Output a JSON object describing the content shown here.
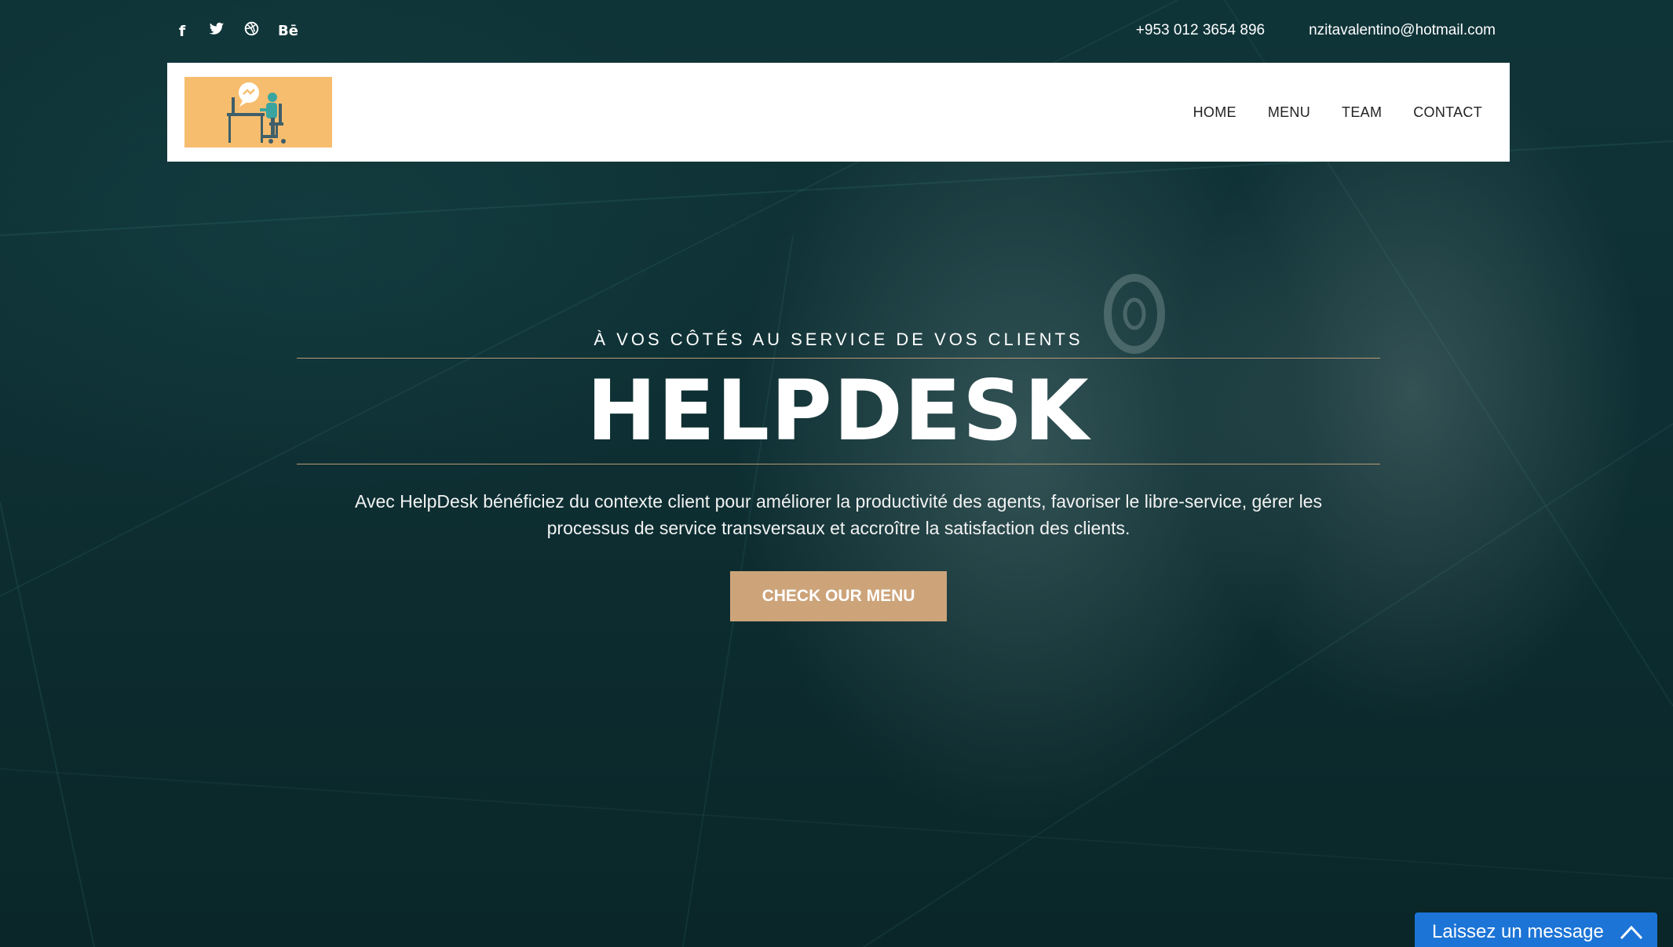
{
  "topbar": {
    "social": [
      {
        "icon": "facebook-icon",
        "glyph": "f"
      },
      {
        "icon": "twitter-icon",
        "glyph": "🐦"
      },
      {
        "icon": "dribbble-icon",
        "glyph": "⊛"
      },
      {
        "icon": "behance-icon",
        "glyph": "Bē"
      }
    ],
    "phone": "+953 012 3654 896",
    "email": "nzitavalentino@hotmail.com"
  },
  "header": {
    "logo_icon": "helpdesk-logo",
    "nav": {
      "home": "HOME",
      "menu": "MENU",
      "team": "TEAM",
      "contact": "CONTACT"
    }
  },
  "hero": {
    "subtitle": "À VOS CÔTÉS AU SERVICE DE VOS CLIENTS",
    "title": "HELPDESK",
    "description": "Avec HelpDesk bénéficiez du contexte client pour améliorer la productivité des agents, favoriser le libre-service, gérer les processus de service transversaux et accroître la satisfaction des clients.",
    "cta_label": "CHECK OUR MENU"
  },
  "chat_widget": {
    "label": "Laissez un message",
    "icon": "chevron-up-icon"
  },
  "colors": {
    "background": "#0f3438",
    "accent": "#cda47a",
    "logo_bg": "#f7bd6f",
    "chat_blue": "#1c74d6"
  }
}
